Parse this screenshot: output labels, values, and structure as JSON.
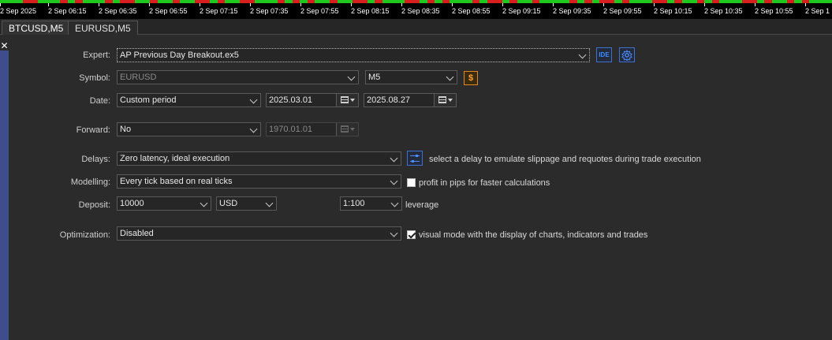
{
  "timebar": {
    "labels": [
      "2 Sep 2025",
      "2 Sep 06:15",
      "2 Sep 06:35",
      "2 Sep 06:55",
      "2 Sep 07:15",
      "2 Sep 07:35",
      "2 Sep 07:55",
      "2 Sep 08:15",
      "2 Sep 08:35",
      "2 Sep 08:55",
      "2 Sep 09:15",
      "2 Sep 09:35",
      "2 Sep 09:55",
      "2 Sep 10:15",
      "2 Sep 10:35",
      "2 Sep 10:55",
      "2 Sep 1"
    ],
    "colors": {
      "up": "#1ec81e",
      "down": "#d81e1e"
    }
  },
  "tabs": [
    {
      "label": "BTCUSD,M5",
      "active": true
    },
    {
      "label": "EURUSD,M5",
      "active": false
    }
  ],
  "form": {
    "expert": {
      "label": "Expert:",
      "value": "AP Previous Day Breakout.ex5",
      "ide_label": "IDE"
    },
    "symbol": {
      "label": "Symbol:",
      "value": "EURUSD",
      "timeframe": "M5",
      "icon": "$"
    },
    "date": {
      "label": "Date:",
      "mode": "Custom period",
      "from": "2025.03.01",
      "to": "2025.08.27"
    },
    "forward": {
      "label": "Forward:",
      "mode": "No",
      "date": "1970.01.01"
    },
    "delays": {
      "label": "Delays:",
      "value": "Zero latency, ideal execution",
      "hint": "select a delay to emulate slippage and requotes during trade execution"
    },
    "modelling": {
      "label": "Modelling:",
      "value": "Every tick based on real ticks",
      "pips_label": "profit in pips for faster calculations",
      "pips_checked": false
    },
    "deposit": {
      "label": "Deposit:",
      "amount": "10000",
      "currency": "USD",
      "leverage": "1:100",
      "leverage_label": "leverage"
    },
    "optimization": {
      "label": "Optimization:",
      "value": "Disabled",
      "visual_label": "visual mode with the display of charts, indicators and trades",
      "visual_checked": true
    }
  }
}
